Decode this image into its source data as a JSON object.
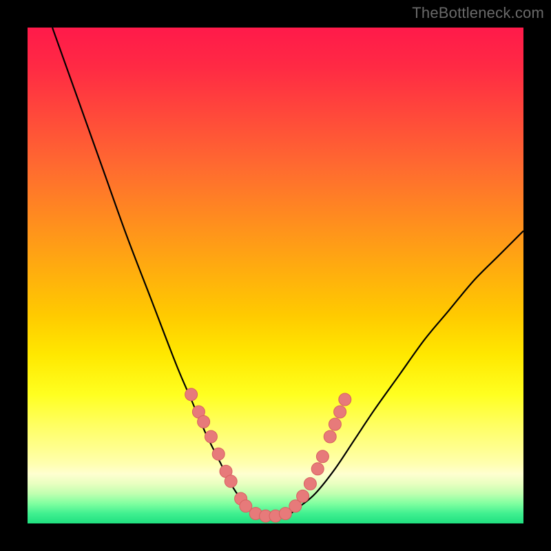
{
  "watermark": "TheBottleneck.com",
  "chart_data": {
    "type": "line",
    "title": "",
    "xlabel": "",
    "ylabel": "",
    "xlim": [
      0,
      100
    ],
    "ylim": [
      0,
      100
    ],
    "series": [
      {
        "name": "curve",
        "x": [
          5,
          10,
          15,
          20,
          25,
          30,
          33,
          36,
          39,
          41,
          43,
          45,
          47,
          49,
          51,
          53,
          55,
          58,
          62,
          66,
          70,
          75,
          80,
          85,
          90,
          95,
          100
        ],
        "y": [
          100,
          86,
          72,
          58,
          45,
          32,
          25,
          18,
          12,
          8,
          5,
          3,
          2,
          1.5,
          1.5,
          2,
          3.5,
          6,
          11,
          17,
          23,
          30,
          37,
          43,
          49,
          54,
          59
        ]
      }
    ],
    "markers": [
      {
        "x": 33.0,
        "y": 26.0
      },
      {
        "x": 34.5,
        "y": 22.5
      },
      {
        "x": 35.5,
        "y": 20.5
      },
      {
        "x": 37.0,
        "y": 17.5
      },
      {
        "x": 38.5,
        "y": 14.0
      },
      {
        "x": 40.0,
        "y": 10.5
      },
      {
        "x": 41.0,
        "y": 8.5
      },
      {
        "x": 43.0,
        "y": 5.0
      },
      {
        "x": 44.0,
        "y": 3.5
      },
      {
        "x": 46.0,
        "y": 2.0
      },
      {
        "x": 48.0,
        "y": 1.5
      },
      {
        "x": 50.0,
        "y": 1.5
      },
      {
        "x": 52.0,
        "y": 2.0
      },
      {
        "x": 54.0,
        "y": 3.5
      },
      {
        "x": 55.5,
        "y": 5.5
      },
      {
        "x": 57.0,
        "y": 8.0
      },
      {
        "x": 58.5,
        "y": 11.0
      },
      {
        "x": 59.5,
        "y": 13.5
      },
      {
        "x": 61.0,
        "y": 17.5
      },
      {
        "x": 62.0,
        "y": 20.0
      },
      {
        "x": 63.0,
        "y": 22.5
      },
      {
        "x": 64.0,
        "y": 25.0
      }
    ],
    "colors": {
      "curve": "#000000",
      "marker_fill": "#e77a7a",
      "marker_stroke": "#d76060"
    }
  }
}
